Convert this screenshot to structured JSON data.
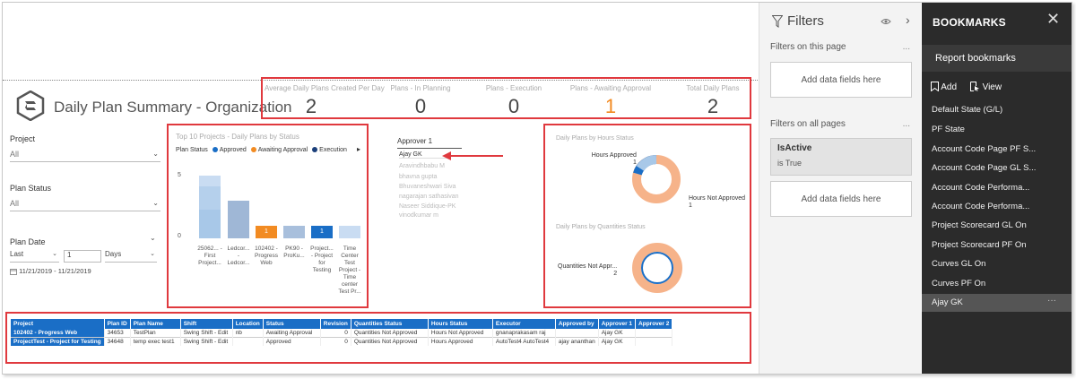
{
  "report": {
    "title": "Daily Plan Summary - Organization"
  },
  "kpis": [
    {
      "label": "Average Daily Plans Created Per Day",
      "value": "2"
    },
    {
      "label": "Plans - In Planning",
      "value": "0"
    },
    {
      "label": "Plans - Execution",
      "value": "0"
    },
    {
      "label": "Plans - Awaiting Approval",
      "value": "1"
    },
    {
      "label": "Total Daily Plans",
      "value": "2"
    }
  ],
  "slicers": {
    "project": {
      "label": "Project",
      "value": "All"
    },
    "plan_status": {
      "label": "Plan Status",
      "value": "All"
    },
    "plan_date": {
      "label": "Plan Date",
      "mode": "Last",
      "count": "1",
      "unit": "Days",
      "range": "11/21/2019 - 11/21/2019"
    }
  },
  "bar_chart": {
    "title": "Top 10 Projects - Daily Plans by Status",
    "legend_title": "Plan Status",
    "legend": [
      {
        "name": "Approved",
        "color": "#1a6ec6"
      },
      {
        "name": "Awaiting Approval",
        "color": "#f28b22"
      },
      {
        "name": "Execution",
        "color": "#1b3f7a"
      }
    ],
    "yticks": [
      "5",
      "0"
    ],
    "categories": [
      "25062... - First Project...",
      "Ledcor... - Ledcor...",
      "102402 - Progress Web",
      "PK90 - ProKu...",
      "Project... - Project for Testing",
      "Time Center Test Project - Time center Test Pr..."
    ],
    "bar_labels": [
      "1",
      "1"
    ]
  },
  "approver": {
    "header": "Approver 1",
    "items": [
      "Ajay GK",
      "Aravindhbabu M",
      "bhavna gupta",
      "Bhuvaneshwari Siva",
      "nagarajan sathasivan",
      "Naseer Siddique-PK",
      "vinodkumar m"
    ]
  },
  "donuts": {
    "hours": {
      "title": "Daily Plans by Hours Status",
      "label_a": "Hours Approved",
      "value_a": "1",
      "label_b": "Hours Not Approved",
      "value_b": "1"
    },
    "quantities": {
      "title": "Daily Plans by Quantities Status",
      "label_a": "Quantities Not Appr...",
      "value_a": "2"
    }
  },
  "table": {
    "columns": [
      "Project",
      "Plan ID",
      "Plan Name",
      "Shift",
      "Location",
      "Status",
      "Revision",
      "Quantities Status",
      "Hours Status",
      "Executor",
      "Approved by",
      "Approver 1",
      "Approver 2"
    ],
    "rows": [
      [
        "102402 - Progress Web",
        "34653",
        "TestPlan",
        "Swing Shift - Edit",
        "nb",
        "Awaiting Approval",
        "0",
        "Quantities Not Approved",
        "Hours Not Approved",
        "gnanaprakasam raj",
        "",
        "Ajay GK",
        ""
      ],
      [
        "ProjectTest - Project for Testing",
        "34648",
        "temp exec test1",
        "Swing Shift - Edit",
        "",
        "Approved",
        "0",
        "Quantities Not Approved",
        "Hours Approved",
        "AutoTest4 AutoTest4",
        "ajay ananthan",
        "Ajay GK",
        ""
      ]
    ]
  },
  "filters": {
    "title": "Filters",
    "on_page": "Filters on this page",
    "on_all": "Filters on all pages",
    "add_fields": "Add data fields here",
    "active_filter": {
      "name": "IsActive",
      "value": "is True"
    },
    "more": "..."
  },
  "bookmarks": {
    "title": "BOOKMARKS",
    "report_bookmarks": "Report bookmarks",
    "add": "Add",
    "view": "View",
    "items": [
      "Default State (G/L)",
      "PF State",
      "Account Code Page PF S...",
      "Account Code Page GL S...",
      "Account Code Performa...",
      "Account Code Performa...",
      "Project Scorecard GL On",
      "Project Scorecard PF On",
      "Curves GL On",
      "Curves PF On",
      "Ajay GK"
    ],
    "selected_more": "···"
  },
  "colors": {
    "accent_blue": "#1a6ec6",
    "orange": "#f28b22",
    "highlight_red": "#e0393e",
    "bookmark_bg": "#2b2b2b"
  }
}
